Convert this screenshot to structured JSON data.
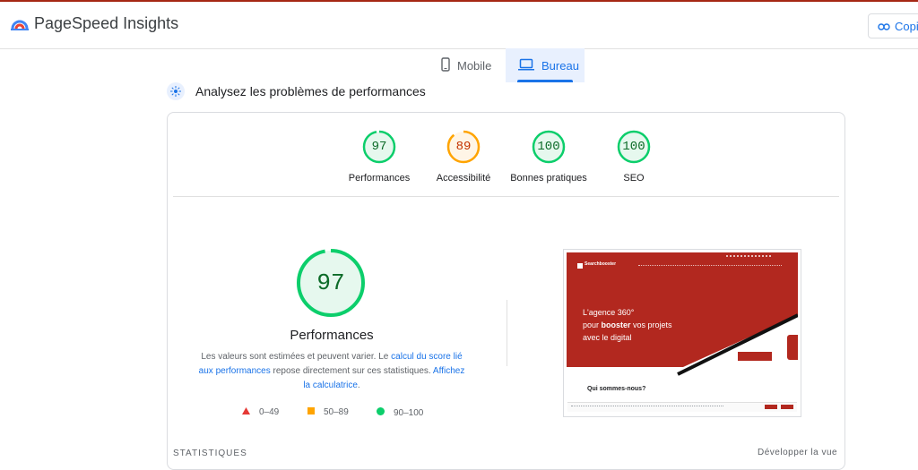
{
  "header": {
    "app_title": "PageSpeed Insights",
    "copy_label": "Copie"
  },
  "tabs": [
    {
      "label": "Mobile",
      "icon": "smartphone-icon"
    },
    {
      "label": "Bureau",
      "icon": "laptop-icon",
      "selected": true
    }
  ],
  "section": {
    "title": "Analysez les problèmes de performances"
  },
  "scores": [
    {
      "value": "97",
      "label": "Performances",
      "status": "pass"
    },
    {
      "value": "89",
      "label": "Accessibilité",
      "status": "average"
    },
    {
      "value": "100",
      "label": "Bonnes pratiques",
      "status": "pass"
    },
    {
      "value": "100",
      "label": "SEO",
      "status": "pass"
    }
  ],
  "performance": {
    "score": "97",
    "score_fraction": 0.97,
    "title": "Performances",
    "desc_1": "Les valeurs sont estimées et peuvent varier. Le ",
    "link_1": "calcul du score lié aux performances",
    "desc_2": " repose directement sur ces statistiques. ",
    "link_2": "Affichez la calculatrice",
    "desc_3": "."
  },
  "legend": [
    {
      "range": "0–49",
      "shape": "triangle",
      "color": "#e53935"
    },
    {
      "range": "50–89",
      "shape": "square",
      "color": "#ffa400"
    },
    {
      "range": "90–100",
      "shape": "circle",
      "color": "#0cce6b"
    }
  ],
  "colors": {
    "pass": "#0cce6b",
    "average": "#ffa400",
    "fail": "#ff4e42",
    "accent": "#1a73e8",
    "brand_red": "#b2281f"
  },
  "screenshot": {
    "logo_text": "Searchbooster",
    "hero_line_1": "L'agence 360°",
    "hero_pre": "pour ",
    "hero_bold": "booster",
    "hero_post": " vos projets",
    "hero_line_3": "avec le digital",
    "heading": "Qui sommes-nous?"
  },
  "footer": {
    "stats_label": "STATISTIQUES",
    "expand_label": "Développer la vue"
  }
}
